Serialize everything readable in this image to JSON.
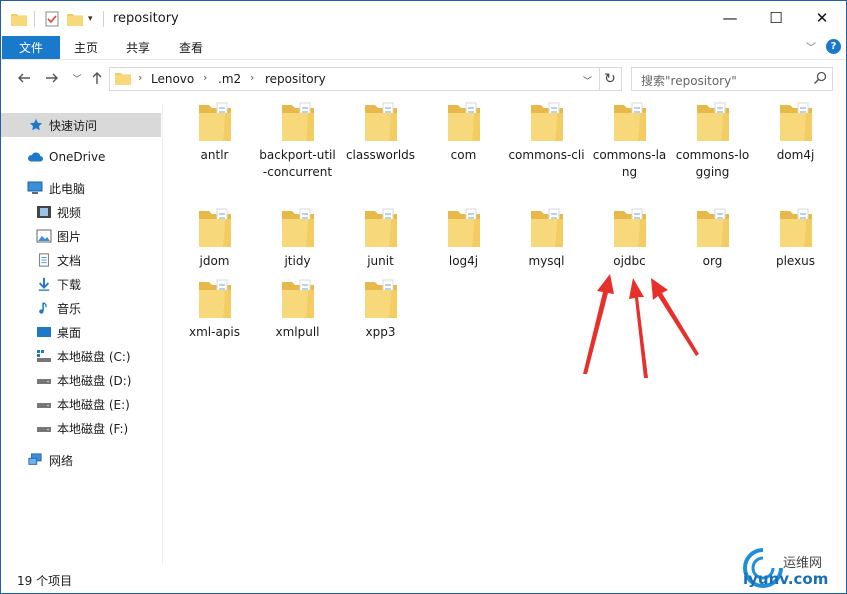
{
  "window": {
    "title": "repository",
    "controls": {
      "minimize": "—",
      "maximize": "☐",
      "close": "✕"
    }
  },
  "ribbon": {
    "file_tab": "文件",
    "tabs": [
      "主页",
      "共享",
      "查看"
    ],
    "help": "?"
  },
  "address": {
    "breadcrumbs": [
      "Lenovo",
      ".m2",
      "repository"
    ],
    "search_placeholder": "搜索\"repository\""
  },
  "sidebar": {
    "items": [
      {
        "label": "快速访问",
        "icon": "star-icon"
      },
      {
        "label": "OneDrive",
        "icon": "cloud-icon"
      },
      {
        "label": "此电脑",
        "icon": "computer-icon"
      },
      {
        "label": "视频",
        "icon": "video-icon"
      },
      {
        "label": "图片",
        "icon": "picture-icon"
      },
      {
        "label": "文档",
        "icon": "document-icon"
      },
      {
        "label": "下载",
        "icon": "download-icon"
      },
      {
        "label": "音乐",
        "icon": "music-icon"
      },
      {
        "label": "桌面",
        "icon": "desktop-icon"
      },
      {
        "label": "本地磁盘 (C:)",
        "icon": "system-drive-icon"
      },
      {
        "label": "本地磁盘 (D:)",
        "icon": "drive-icon"
      },
      {
        "label": "本地磁盘 (E:)",
        "icon": "drive-icon"
      },
      {
        "label": "本地磁盘 (F:)",
        "icon": "drive-icon"
      },
      {
        "label": "网络",
        "icon": "network-icon"
      }
    ]
  },
  "folders": [
    "antlr",
    "backport-util-concurrent",
    "classworlds",
    "com",
    "commons-cli",
    "commons-lang",
    "commons-logging",
    "dom4j",
    "jdom",
    "jtidy",
    "junit",
    "log4j",
    "mysql",
    "ojdbc",
    "org",
    "plexus",
    "xml-apis",
    "xmlpull",
    "xpp3"
  ],
  "status": {
    "item_count": "19 个项目"
  },
  "watermark": {
    "top": "运维网",
    "bottom": "iyunv.com"
  },
  "colors": {
    "accent": "#1979ca",
    "folder": "#f3cc62",
    "arrow": "#e8302a"
  }
}
